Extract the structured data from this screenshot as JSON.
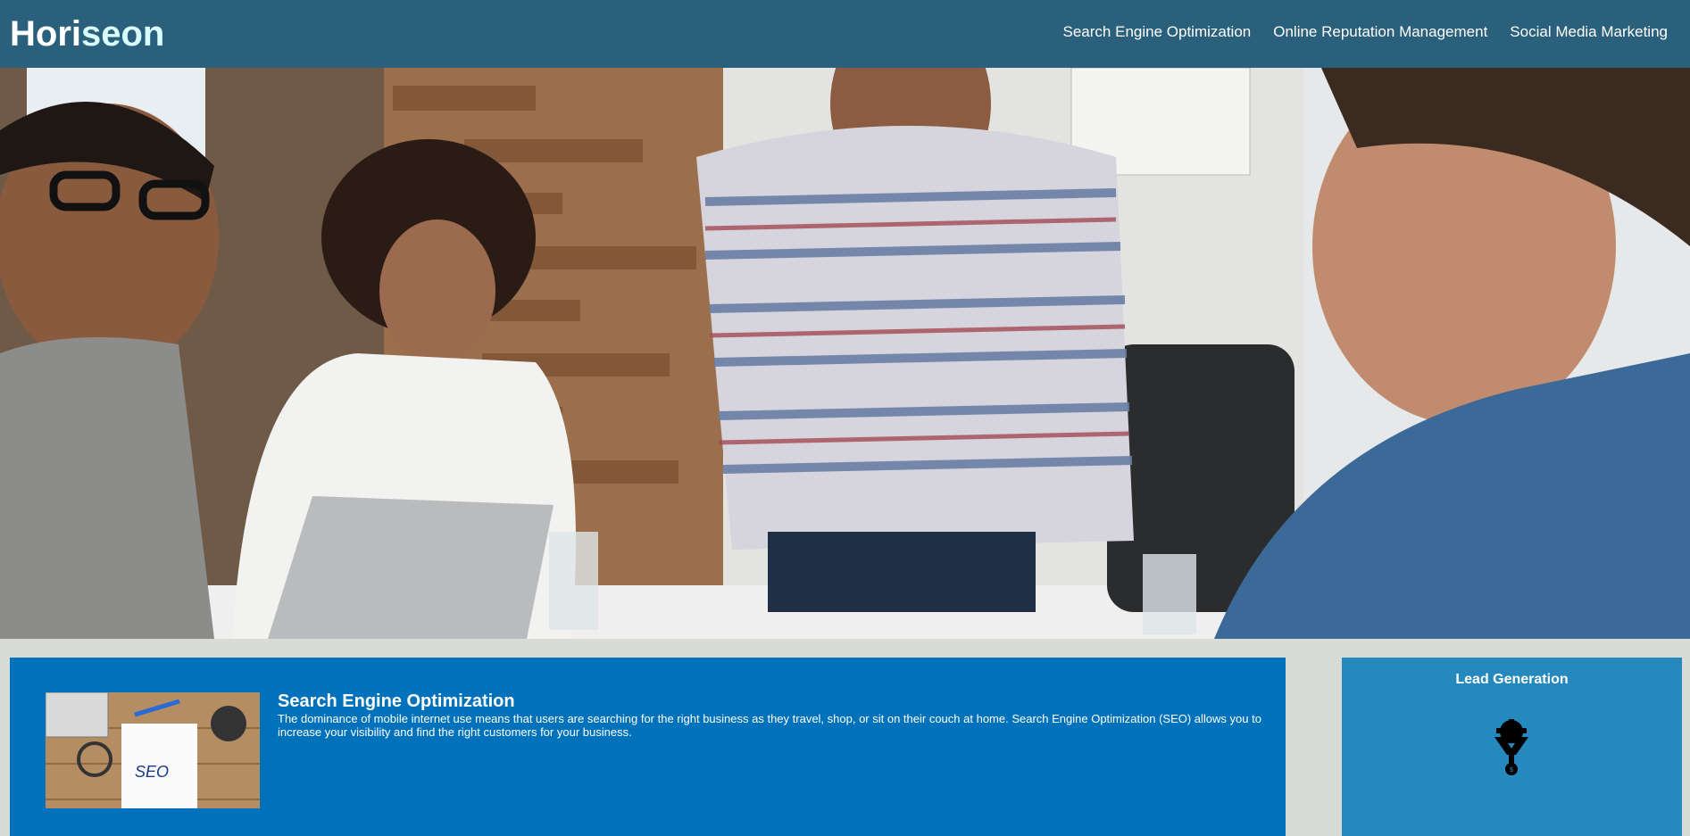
{
  "header": {
    "logo_prefix": "Hori",
    "logo_accent": "seon",
    "nav": [
      {
        "label": "Search Engine Optimization"
      },
      {
        "label": "Online Reputation Management"
      },
      {
        "label": "Social Media Marketing"
      }
    ]
  },
  "hero": {
    "image": "team-meeting-photo"
  },
  "content": {
    "title": "Search Engine Optimization",
    "body": "The dominance of mobile internet use means that users are searching for the right business as they travel, shop, or sit on their couch at home. Search Engine Optimization (SEO) allows you to increase your visibility and find the right customers for your business.",
    "image": "seo-notebook-photo",
    "image_text": "SEO"
  },
  "aside": {
    "title": "Lead Generation",
    "icon": "lead-generation-funnel-icon"
  },
  "colors": {
    "header_bg": "#2a607c",
    "logo_accent": "#d9ffff",
    "content_bg": "#0072bb",
    "aside_bg": "#2589bd",
    "page_bg": "#d9dcd6"
  }
}
